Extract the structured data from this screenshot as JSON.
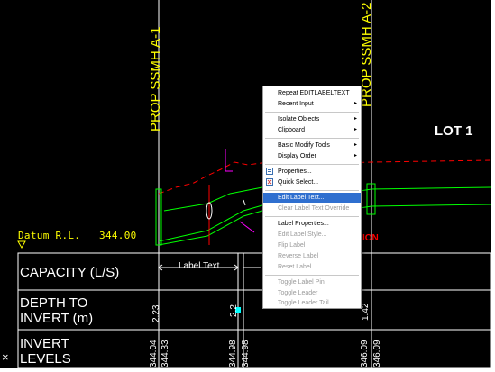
{
  "drawing": {
    "manholes": [
      "PROP SSMH A-1",
      "PROP SSMH A-2"
    ],
    "lot_label": "LOT 1",
    "datum": {
      "label": "Datum R.L.",
      "value": "344.00"
    },
    "label_text": "Label Text",
    "red_text": "ION",
    "rows": {
      "capacity": "CAPACITY (L/S)",
      "depth_line1": "DEPTH TO",
      "depth_line2": "INVERT (m)",
      "invert_line1": "INVERT",
      "invert_line2": "LEVELS"
    },
    "depths": {
      "a1": "2.23",
      "mid": "2.2",
      "a2": "1.42"
    },
    "inverts": {
      "a1_a": "344.04",
      "a1_b": "344.33",
      "mid_a": "344.98",
      "mid_b": "344.98",
      "a2_a": "346.09",
      "a2_b": "346.09"
    },
    "ucs_icon": "ucs-x-icon"
  },
  "colors": {
    "background": "#000000",
    "manhole_text": "#ffff00",
    "pipe": "#00ff00",
    "ground": "#ff0000",
    "selection": "#2f6fcf"
  },
  "context_menu": {
    "repeat": "Repeat EDITLABELTEXT",
    "recent_input": "Recent Input",
    "isolate_objects": "Isolate Objects",
    "clipboard": "Clipboard",
    "basic_modify_tools": "Basic Modify Tools",
    "display_order": "Display Order",
    "properties": "Properties...",
    "quick_select": "Quick Select...",
    "edit_label_text": "Edit Label Text...",
    "clear_override": "Clear Label Text Override",
    "label_properties": "Label Properties...",
    "edit_label_style": "Edit Label Style...",
    "flip_label": "Flip Label",
    "reverse_label": "Reverse Label",
    "reset_label": "Reset Label",
    "toggle_label_pin": "Toggle Label Pin",
    "toggle_leader": "Toggle Leader",
    "toggle_leader_tail": "Toggle Leader Tail",
    "submenu_arrow": "▸"
  }
}
